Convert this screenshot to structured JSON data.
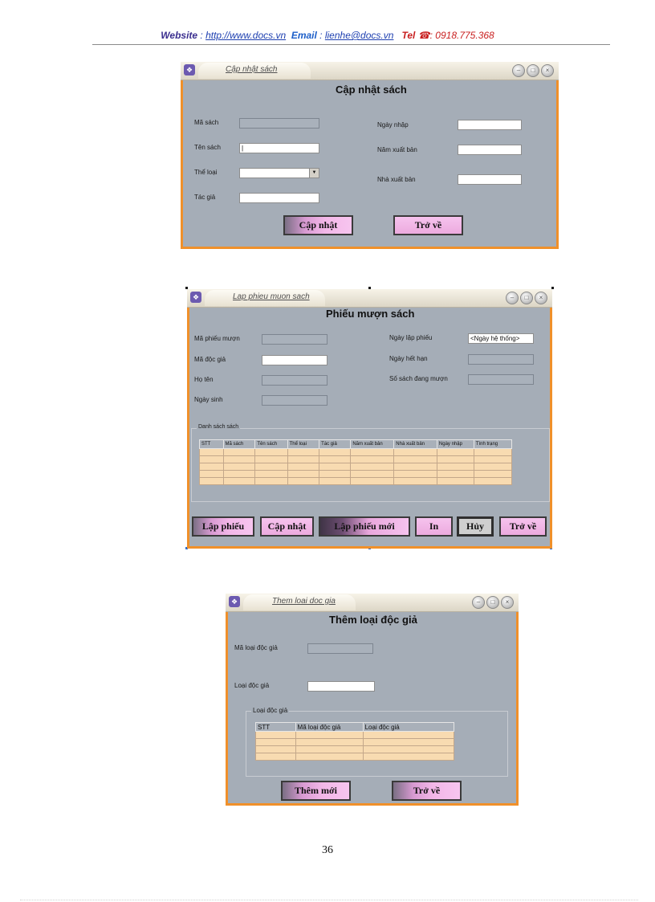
{
  "header": {
    "website_label": "Website",
    "website_sep": " : ",
    "website_url": "http://www.docs.vn",
    "email_label": "Email",
    "email_sep": " : ",
    "email_value": "lienhe@docs.vn",
    "tel_label": "Tel",
    "tel_icon": "☎",
    "tel_value": ": 0918.775.368"
  },
  "form1": {
    "window_title": "Cập nhật sách",
    "heading": "Cập nhật sách",
    "labels": {
      "ma_sach": "Mã sách",
      "ten_sach": "Tên sách",
      "the_loai": "Thể loại",
      "tac_gia": "Tác giả",
      "ngay_nhap": "Ngày nhập",
      "nam_xuat_ban": "Năm xuất bản",
      "nha_xuat_ban": "Nhà xuất bản"
    },
    "buttons": {
      "cap_nhat": "Cập nhật",
      "tro_ve": "Trở về"
    }
  },
  "form2": {
    "window_title": "Lap phieu muon sach",
    "heading": "Phiếu mượn sách",
    "labels": {
      "ma_phieu_muon": "Mã phiếu mượn",
      "ma_doc_gia": "Mã độc giả",
      "ho_ten": "Họ tên",
      "ngay_sinh": "Ngày sinh",
      "ngay_lap_phieu": "Ngày lập phiếu",
      "ngay_het_han": "Ngày hết hạn",
      "so_sach_dang_muon": "Số sách đang mượn"
    },
    "ngay_lap_phieu_value": "<Ngày hệ thống>",
    "group_label": "Danh sách sách",
    "columns": [
      "STT",
      "Mã sách",
      "Tên sách",
      "Thể loại",
      "Tác giả",
      "Năm xuất bản",
      "Nhà xuất bản",
      "Ngày nhập",
      "Tình trạng"
    ],
    "buttons": {
      "lap_phieu": "Lập phiếu",
      "cap_nhat": "Cập nhật",
      "lap_phieu_moi": "Lập phiếu mới",
      "in": "In",
      "huy": "Hủy",
      "tro_ve": "Trở về"
    }
  },
  "form3": {
    "window_title": "Them loai doc gia",
    "heading": "Thêm loại độc giả",
    "labels": {
      "ma_loai_doc_gia": "Mã loại độc giả",
      "loai_doc_gia": "Loại độc giả"
    },
    "group_label": "Loại độc giả",
    "columns": [
      "STT",
      "Mã loại độc giả",
      "Loại độc giả"
    ],
    "buttons": {
      "them_moi": "Thêm mới",
      "tro_ve": "Trở về"
    }
  },
  "page_number": "36"
}
